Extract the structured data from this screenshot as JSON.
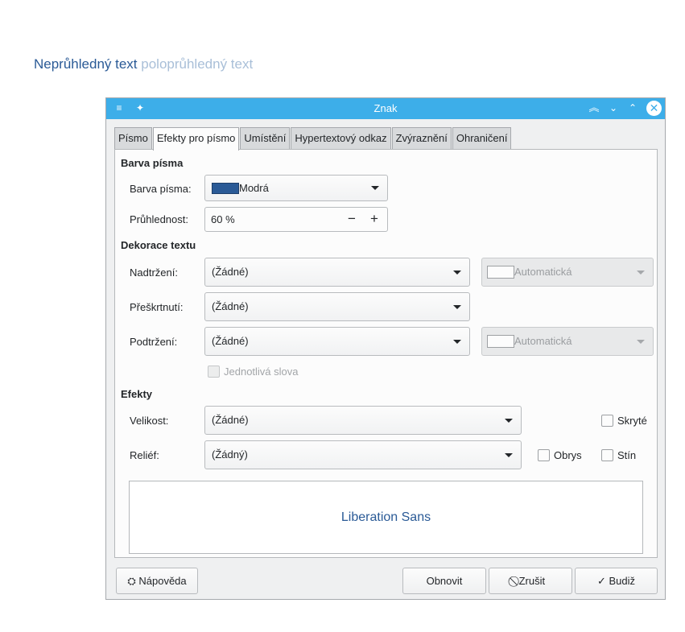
{
  "heading": {
    "opaque_text": "Neprůhledný text",
    "semi_text": "poloprůhledný text"
  },
  "window": {
    "title": "Znak"
  },
  "tabs": [
    {
      "label": "Písmo"
    },
    {
      "label": "Efekty pro písmo"
    },
    {
      "label": "Umístění"
    },
    {
      "label": "Hypertextový odkaz"
    },
    {
      "label": "Zvýraznění"
    },
    {
      "label": "Ohraničení"
    }
  ],
  "font_color": {
    "section": "Barva písma",
    "color_label": "Barva písma:",
    "color_value": "Modrá",
    "color_swatch": "#2a5a96",
    "transparency_label": "Průhlednost:",
    "transparency_value": "60 %"
  },
  "decoration": {
    "section": "Dekorace textu",
    "overline_label": "Nadtržení:",
    "overline_value": "(Žádné)",
    "overline_color": "Automatická",
    "strike_label": "Přeškrtnutí:",
    "strike_value": "(Žádné)",
    "underline_label": "Podtržení:",
    "underline_value": "(Žádné)",
    "underline_color": "Automatická",
    "individual_words": "Jednotlivá slova"
  },
  "effects": {
    "section": "Efekty",
    "case_label": "Velikost:",
    "case_value": "(Žádné)",
    "hidden_label": "Skryté",
    "relief_label": "Reliéf:",
    "relief_value": "(Žádný)",
    "outline_label": "Obrys",
    "shadow_label": "Stín"
  },
  "preview": {
    "text": "Liberation Sans"
  },
  "buttons": {
    "help": "Nápověda",
    "reset": "Obnovit",
    "cancel": "Zrušit",
    "ok": "Budiž"
  },
  "colors": {
    "accent": "#3daee9",
    "text_blue": "#2a5a96"
  }
}
